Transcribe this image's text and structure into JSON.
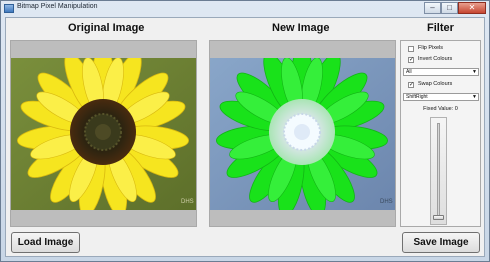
{
  "window": {
    "title": "Bitmap Pixel Manipulation",
    "minimize_glyph": "–",
    "maximize_glyph": "□",
    "close_glyph": "✕"
  },
  "headings": {
    "original": "Original Image",
    "new": "New Image",
    "filter": "Filter"
  },
  "images": {
    "original_watermark": "DHS",
    "new_watermark": "DHS"
  },
  "filter": {
    "flip_pixels": {
      "label": "Flip Pixels",
      "checked": false
    },
    "invert_colours": {
      "label": "Invert Colours",
      "checked": true
    },
    "channel_select": {
      "value": "All"
    },
    "swap_colours": {
      "label": "Swap Colours",
      "checked": true
    },
    "shift_select": {
      "value": "ShiftRight"
    },
    "fixed_value_label": "Fixed Value: 0",
    "fixed_value": 0
  },
  "buttons": {
    "load": "Load Image",
    "save": "Save Image"
  },
  "colors": {
    "accent": "#3f79bd",
    "flower_petal": "#f6e51f",
    "inverted_petal": "#19e21a"
  }
}
